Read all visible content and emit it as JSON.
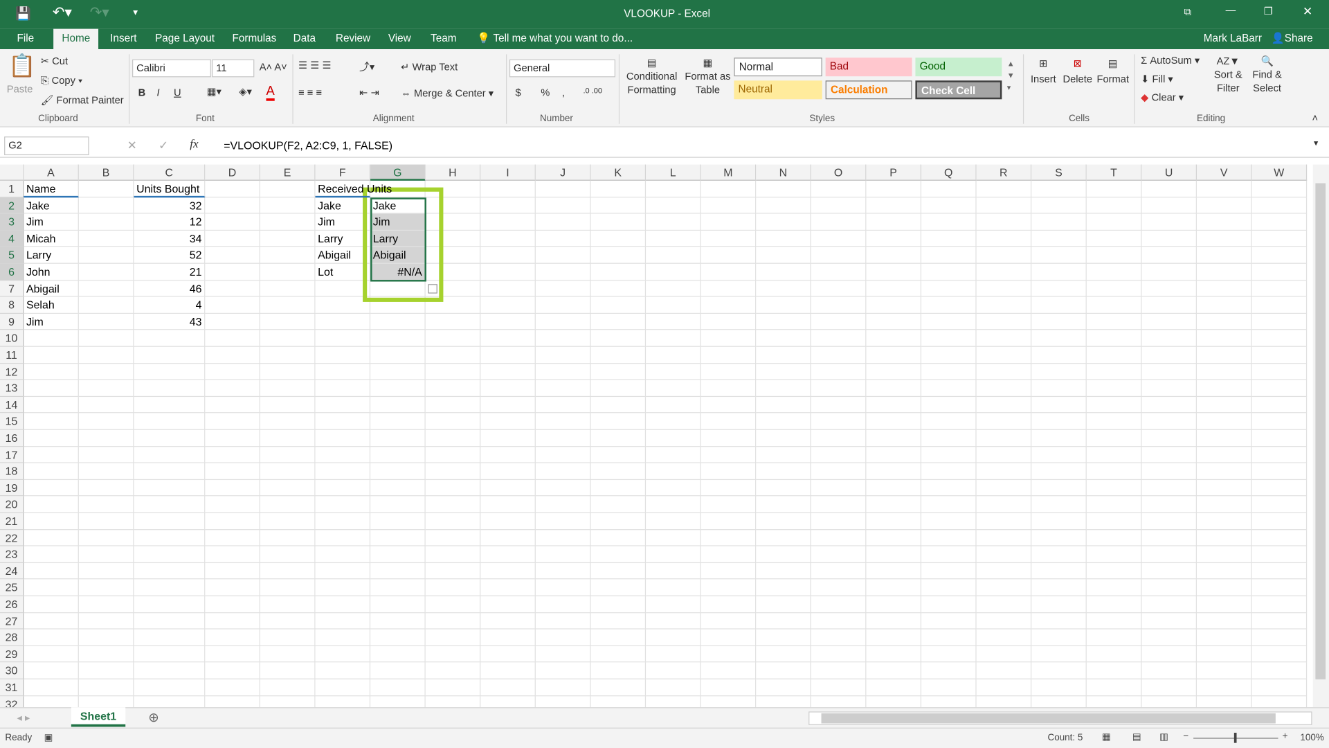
{
  "window": {
    "title": "VLOOKUP - Excel",
    "user": "Mark LaBarr",
    "share": "Share"
  },
  "tabs": [
    "File",
    "Home",
    "Insert",
    "Page Layout",
    "Formulas",
    "Data",
    "Review",
    "View",
    "Team"
  ],
  "tell_me": "Tell me what you want to do...",
  "clipboard": {
    "paste": "Paste",
    "cut": "Cut",
    "copy": "Copy",
    "format_painter": "Format Painter",
    "label": "Clipboard"
  },
  "font": {
    "name": "Calibri",
    "size": "11",
    "label": "Font",
    "bold": "B",
    "italic": "I",
    "underline": "U"
  },
  "alignment": {
    "wrap": "Wrap Text",
    "merge": "Merge & Center",
    "label": "Alignment"
  },
  "number": {
    "format": "General",
    "label": "Number",
    "currency": "$",
    "percent": "%",
    "comma": ","
  },
  "styles": {
    "conditional": "Conditional Formatting",
    "format_table": "Format as Table",
    "normal": "Normal",
    "bad": "Bad",
    "good": "Good",
    "neutral": "Neutral",
    "calculation": "Calculation",
    "check": "Check Cell",
    "label": "Styles"
  },
  "cells": {
    "insert": "Insert",
    "delete": "Delete",
    "format": "Format",
    "label": "Cells"
  },
  "editing": {
    "autosum": "AutoSum",
    "fill": "Fill",
    "clear": "Clear",
    "sort": "Sort & Filter",
    "find": "Find & Select",
    "label": "Editing"
  },
  "formula_bar": {
    "name_box": "G2",
    "fx": "fx",
    "formula": "=VLOOKUP(F2, A2:C9, 1, FALSE)"
  },
  "columns": [
    "A",
    "B",
    "C",
    "D",
    "E",
    "F",
    "G",
    "H",
    "I",
    "J",
    "K",
    "L",
    "M",
    "N",
    "O",
    "P",
    "Q",
    "R",
    "S",
    "T",
    "U",
    "V",
    "W"
  ],
  "sheet": {
    "A": [
      "Name",
      "Jake",
      "Jim",
      "Micah",
      "Larry",
      "John",
      "Abigail",
      "Selah",
      "Jim"
    ],
    "C": [
      "Units Bought",
      "32",
      "12",
      "34",
      "52",
      "21",
      "46",
      "4",
      "43"
    ],
    "F": [
      "Received Units",
      "Jake",
      "Jim",
      "Larry",
      "Abigail",
      "Lot"
    ],
    "G": [
      "",
      "Jake",
      "Jim",
      "Larry",
      "Abigail",
      "#N/A"
    ]
  },
  "sheet_tab": "Sheet1",
  "status": {
    "ready": "Ready",
    "count": "Count: 5",
    "zoom": "100%"
  },
  "colors": {
    "accent": "#217346",
    "highlight": "#a6d22e"
  }
}
